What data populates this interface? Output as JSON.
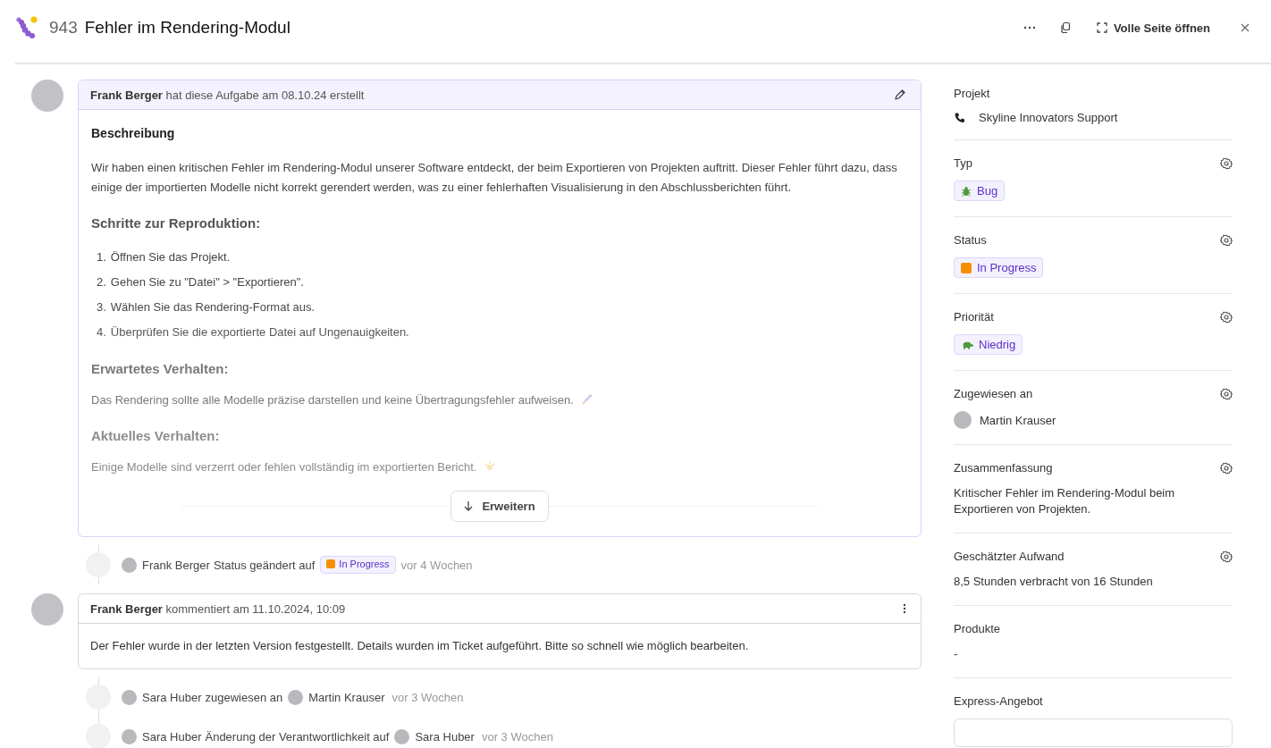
{
  "header": {
    "number": "943",
    "title": "Fehler im Rendering-Modul",
    "open_label": "Volle Seite öffnen"
  },
  "description": {
    "author": "Frank Berger",
    "meta": "hat diese Aufgabe am 08.10.24 erstellt",
    "expand_label": "Erweitern",
    "blocks": [
      {
        "kind": "title",
        "text": "Beschreibung"
      },
      {
        "kind": "paragraph",
        "text": "Wir haben einen kritischen Fehler im Rendering-Modul unserer Software entdeckt, der beim Exportieren von Projekten auftritt. Dieser Fehler führt dazu, dass einige der importierten Modelle nicht korrekt gerendert werden, was zu einer fehlerhaften Visualisierung in den Abschlussberichten führt."
      },
      {
        "kind": "heading",
        "text": "Schritte zur Reproduktion:"
      },
      {
        "kind": "list",
        "items": [
          {
            "number": "1.",
            "text": "Öffnen Sie das Projekt."
          },
          {
            "number": "2.",
            "text": "Gehen Sie zu \"Datei\" > \"Exportieren\"."
          },
          {
            "number": "3.",
            "text": "Wählen Sie das Rendering-Format aus."
          },
          {
            "number": "4.",
            "text": "Überprüfen Sie die exportierte Datei auf Ungenauigkeiten."
          }
        ]
      },
      {
        "kind": "heading",
        "text": "Erwartetes Verhalten:"
      },
      {
        "kind": "paragraph",
        "text": "Das Rendering sollte alle Modelle präzise darstellen und keine Übertragungsfehler aufweisen."
      },
      {
        "kind": "heading",
        "text": "Aktuelles Verhalten:"
      },
      {
        "kind": "paragraph",
        "text": "Einige Modelle sind verzerrt oder fehlen vollständig im exportierten Bericht."
      }
    ]
  },
  "timeline": [
    {
      "kind": "status_change",
      "actor": "Frank Berger",
      "text": "Status geändert auf",
      "badge": {
        "label": "In Progress",
        "color": "#f59006"
      },
      "time": "vor 4 Wochen"
    },
    {
      "kind": "comment",
      "author": "Frank Berger",
      "meta": "kommentiert am 11.10.2024, 10:09",
      "body": "Der Fehler wurde in der letzten Version festgestellt. Details wurden im Ticket aufgeführt. Bitte so schnell wie möglich bearbeiten."
    },
    {
      "kind": "assignment",
      "actor": "Sara Huber",
      "text": "zugewiesen an",
      "target": "Martin Krauser",
      "time": "vor 3 Wochen"
    },
    {
      "kind": "responsibility_change",
      "actor": "Sara Huber",
      "text": "Änderung der Verantwortlichkeit auf",
      "target": "Sara Huber",
      "time": "vor 3 Wochen"
    }
  ],
  "sidebar": [
    {
      "kind": "project",
      "label": "Projekt",
      "settings": false,
      "value": "Skyline Innovators Support"
    },
    {
      "kind": "type",
      "label": "Typ",
      "settings": true,
      "value": "Bug"
    },
    {
      "kind": "status",
      "label": "Status",
      "settings": true,
      "value": "In Progress",
      "color": "#f59006"
    },
    {
      "kind": "priority",
      "label": "Priorität",
      "settings": true,
      "value": "Niedrig"
    },
    {
      "kind": "person",
      "label": "Zugewiesen an",
      "settings": true,
      "value": "Martin Krauser"
    },
    {
      "kind": "text",
      "label": "Zusammenfassung",
      "settings": true,
      "value": "Kritischer Fehler im Rendering-Modul beim Exportieren von Projekten."
    },
    {
      "kind": "text",
      "label": "Geschätzter Aufwand",
      "settings": true,
      "value": "8,5 Stunden verbracht von 16 Stunden"
    },
    {
      "kind": "text",
      "label": "Produkte",
      "settings": false,
      "value": "-"
    },
    {
      "kind": "field",
      "label": "Express-Angebot",
      "settings": false
    }
  ]
}
